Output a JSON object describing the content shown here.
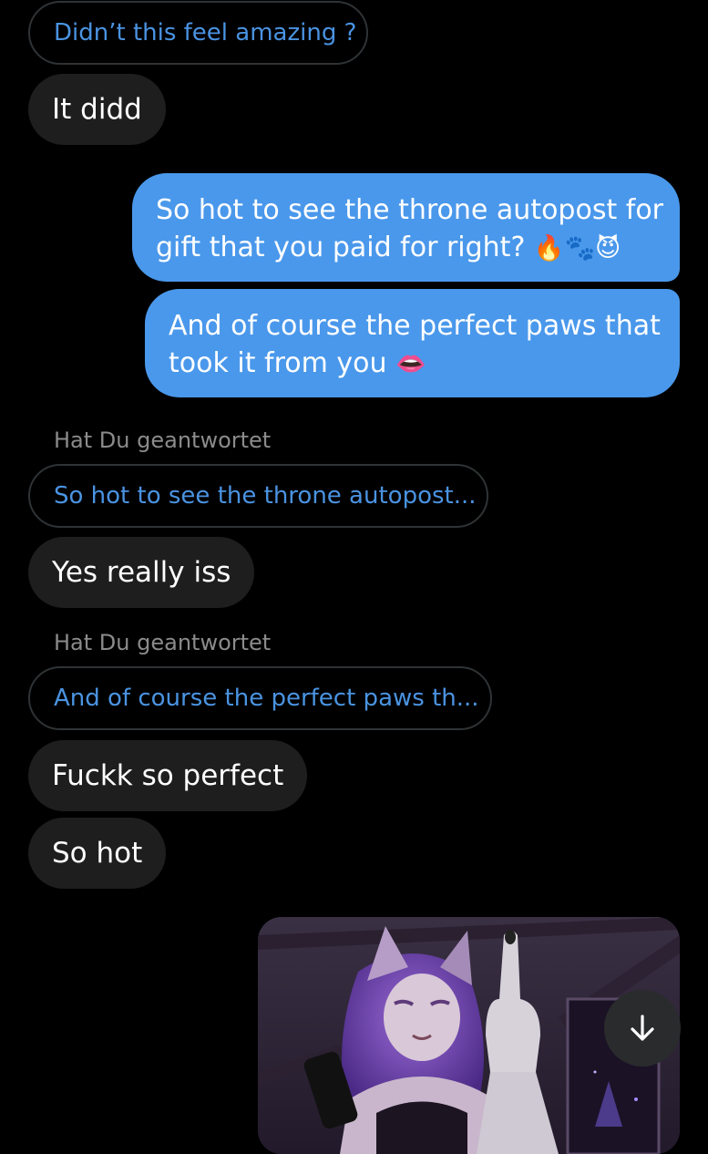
{
  "messages": [
    {
      "kind": "reply-preview",
      "text": "Didn’t this feel amazing ?"
    },
    {
      "kind": "incoming",
      "text": "It didd"
    },
    {
      "kind": "outgoing",
      "line1": "So hot to see the throne autopost for",
      "line2": "gift that you paid for right?",
      "emoji": "🔥🐾😈"
    },
    {
      "kind": "outgoing",
      "line1": "And of course the perfect paws that",
      "line2": "took it from you",
      "emoji": "👄"
    },
    {
      "kind": "replied-label",
      "text": "Hat Du geantwortet"
    },
    {
      "kind": "reply-preview",
      "text": "So hot to see the throne autopost..."
    },
    {
      "kind": "incoming",
      "text": "Yes really iss"
    },
    {
      "kind": "replied-label",
      "text": "Hat Du geantwortet"
    },
    {
      "kind": "reply-preview",
      "text": "And of course the perfect paws th..."
    },
    {
      "kind": "incoming",
      "text": "Fuckk so perfect"
    },
    {
      "kind": "incoming",
      "text": "So hot"
    }
  ],
  "media": {
    "kind": "image-attachment",
    "subject": "anime wolf girl with purple hair raising middle finger"
  },
  "scroll_button": {
    "icon": "arrow-down-icon"
  },
  "colors": {
    "background": "#000000",
    "incoming_bubble": "#1e1e1e",
    "outgoing_bubble": "#4a98eb",
    "reply_text": "#4a93e1",
    "muted_text": "#8b8b8b"
  }
}
